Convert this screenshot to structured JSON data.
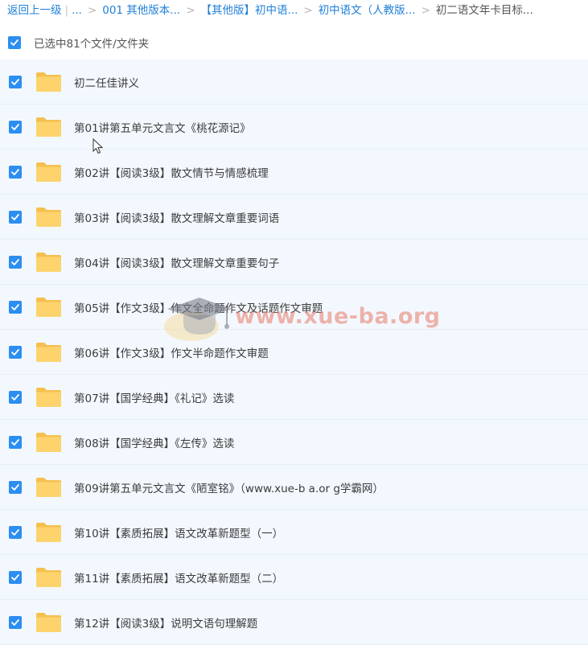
{
  "breadcrumb": {
    "back": "返回上一级",
    "ellipsis": "...",
    "crumbs": [
      "001 其他版本...",
      "【其他版】初中语...",
      "初中语文（人教版...",
      "初二语文年卡目标..."
    ]
  },
  "selection": {
    "label": "已选中81个文件/文件夹"
  },
  "files": [
    {
      "name": "初二任佳讲义"
    },
    {
      "name": "第01讲第五单元文言文《桃花源记》"
    },
    {
      "name": "第02讲【阅读3级】散文情节与情感梳理"
    },
    {
      "name": "第03讲【阅读3级】散文理解文章重要词语"
    },
    {
      "name": "第04讲【阅读3级】散文理解文章重要句子"
    },
    {
      "name": "第05讲【作文3级】作文全命题作文及话题作文审题"
    },
    {
      "name": "第06讲【作文3级】作文半命题作文审题"
    },
    {
      "name": "第07讲【国学经典】《礼记》选读"
    },
    {
      "name": "第08讲【国学经典】《左传》选读"
    },
    {
      "name": "第09讲第五单元文言文《陋室铭》（www.xue-b a.or g学霸网）"
    },
    {
      "name": "第10讲【素质拓展】语文改革新题型（一）"
    },
    {
      "name": "第11讲【素质拓展】语文改革新题型（二）"
    },
    {
      "name": "第12讲【阅读3级】说明文语句理解题"
    }
  ],
  "watermark": {
    "text": "www.xue-ba.org"
  },
  "colors": {
    "accent": "#2c8ef0",
    "row_bg": "#f3f8fe",
    "folder": "#fcd46b"
  }
}
